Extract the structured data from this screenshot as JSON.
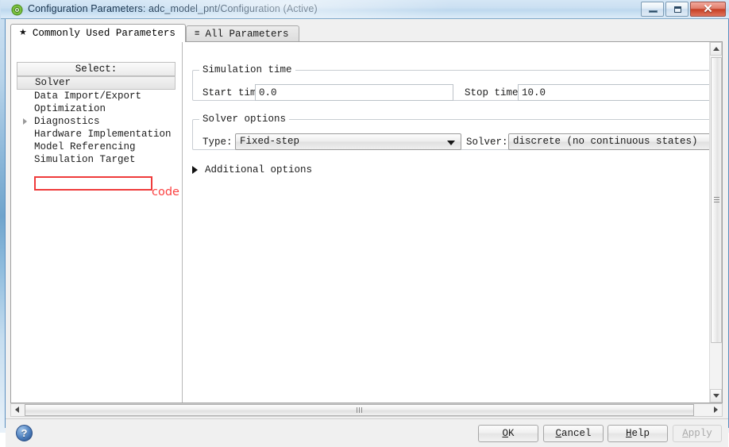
{
  "window": {
    "title": "Configuration Parameters: adc_model_pnt/Configuration (Active)",
    "icon": "simulink-config-icon",
    "controls": {
      "minimize": "minimize-icon",
      "maximize": "maximize-icon",
      "close": "✕"
    }
  },
  "tabs": [
    {
      "label": "Commonly Used Parameters",
      "icon": "★",
      "icon_name": "star-icon",
      "active": true
    },
    {
      "label": "All Parameters",
      "icon": "≡",
      "icon_name": "list-icon",
      "active": false
    }
  ],
  "sidebar": {
    "header": "Select:",
    "items": [
      {
        "label": "Solver",
        "selected": true,
        "expandable": false
      },
      {
        "label": "Data Import/Export",
        "selected": false,
        "expandable": false
      },
      {
        "label": "Optimization",
        "selected": false,
        "expandable": false
      },
      {
        "label": "Diagnostics",
        "selected": false,
        "expandable": true
      },
      {
        "label": "Hardware Implementation",
        "selected": false,
        "expandable": false
      },
      {
        "label": "Model Referencing",
        "selected": false,
        "expandable": false
      },
      {
        "label": "Simulation Target",
        "selected": false,
        "expandable": false
      }
    ]
  },
  "annotation": {
    "text": "code generation is losed",
    "color": "#fb4141",
    "box_color": "#ef3b3b"
  },
  "main": {
    "simulation_time": {
      "legend": "Simulation time",
      "start_label": "Start time:",
      "start_value": "0.0",
      "stop_label": "Stop time:",
      "stop_value": "10.0"
    },
    "solver_options": {
      "legend": "Solver options",
      "type_label": "Type:",
      "type_value": "Fixed-step",
      "solver_label": "Solver:",
      "solver_value": "discrete (no continuous states)"
    },
    "additional_options": {
      "label": "Additional options",
      "expanded": false,
      "icon": "expand-triangle-icon"
    }
  },
  "footer": {
    "help_icon": "question-mark-icon",
    "buttons": [
      {
        "id": "ok",
        "label": "OK",
        "mnemonic": "O",
        "enabled": true
      },
      {
        "id": "cancel",
        "label": "Cancel",
        "mnemonic": "C",
        "enabled": true
      },
      {
        "id": "help",
        "label": "Help",
        "mnemonic": "H",
        "enabled": true
      },
      {
        "id": "apply",
        "label": "Apply",
        "mnemonic": "A",
        "enabled": false
      }
    ]
  },
  "scrollbars": {
    "vertical": {
      "up": "▲",
      "down": "▼"
    },
    "horizontal": {
      "left": "◀",
      "right": "▶"
    }
  }
}
